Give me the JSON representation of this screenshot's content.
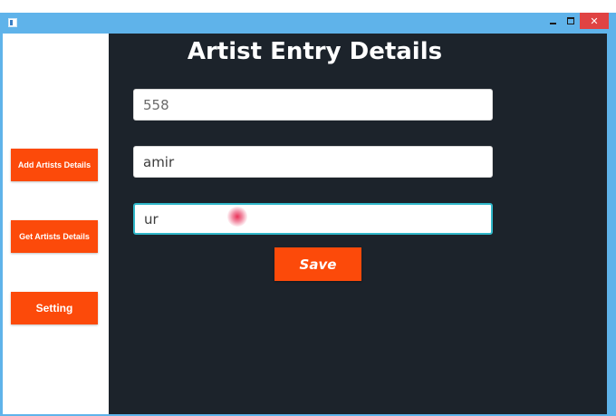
{
  "window": {
    "close_glyph": "✕"
  },
  "sidebar": {
    "add_label": "Add Artists Details",
    "get_label": "Get Artists Details",
    "setting_label": "Setting"
  },
  "main": {
    "title": "Artist Entry Details",
    "fields": [
      {
        "value": "558"
      },
      {
        "value": "amir"
      },
      {
        "value": "ur"
      }
    ],
    "save_label": "Save"
  },
  "colors": {
    "accent": "#fc4a0a",
    "panel_bg": "#1c232b",
    "titlebar": "#5fb3ea",
    "close": "#e04343",
    "focus_border": "#2fb7c9"
  }
}
